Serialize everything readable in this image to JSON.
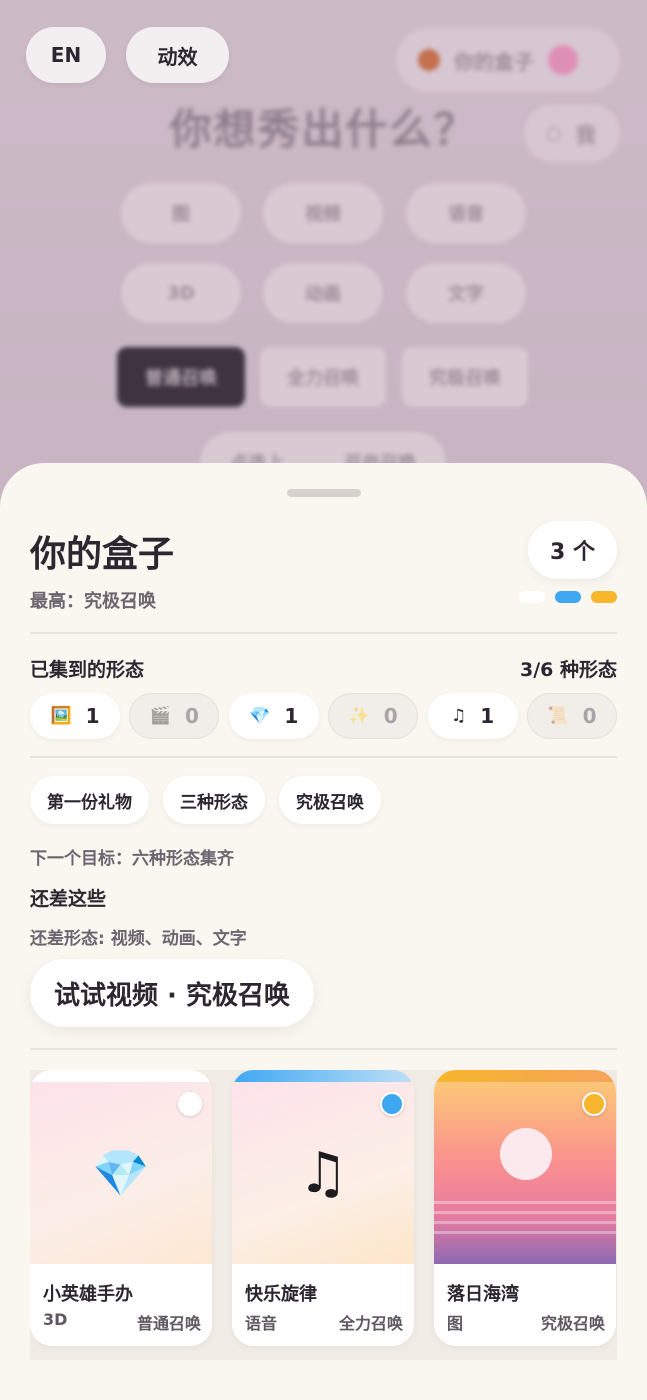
{
  "top_buttons": {
    "lang": "EN",
    "effects": "动效"
  },
  "background": {
    "title": "你想秀出什么？",
    "box_pill": "你的盒子",
    "me_pill": "我",
    "type_chips": [
      "图",
      "视频",
      "语音",
      "3D",
      "动画",
      "文字"
    ],
    "summon_chips": [
      "普通召唤",
      "全力召唤",
      "究极召唤"
    ],
    "bottom_chips": [
      "点选上",
      "开启召唤"
    ]
  },
  "sheet": {
    "title": "你的盒子",
    "best": "最高：究极召唤",
    "count": "3 个",
    "dot_colors": [
      "#ffffff",
      "#3ea7f2",
      "#f7b62c"
    ],
    "collected_label": "已集到的形态",
    "collected_progress": "3/6 种形态",
    "forms": [
      {
        "icon": "🖼️",
        "count": "1",
        "active": true
      },
      {
        "icon": "🎬",
        "count": "0",
        "active": false
      },
      {
        "icon": "💎",
        "count": "1",
        "active": true
      },
      {
        "icon": "✨",
        "count": "0",
        "active": false
      },
      {
        "icon": "♫",
        "count": "1",
        "active": true
      },
      {
        "icon": "📜",
        "count": "0",
        "active": false
      }
    ],
    "achievements": [
      "第一份礼物",
      "三种形态",
      "究极召唤"
    ],
    "next_goal": "下一个目标：六种形态集齐",
    "missing_heading": "还差这些",
    "missing_text": "还差形态: 视频、动画、文字",
    "cta": "试试视频 · 究极召唤",
    "cards": [
      {
        "name": "小英雄手办",
        "type": "3D",
        "tier": "普通召唤",
        "icon": "💎",
        "accent": "#ffffff"
      },
      {
        "name": "快乐旋律",
        "type": "语音",
        "tier": "全力召唤",
        "icon": "♫",
        "accent": "#3ea7f2"
      },
      {
        "name": "落日海湾",
        "type": "图",
        "tier": "究极召唤",
        "icon": "",
        "accent": "#f7b62c"
      }
    ]
  }
}
